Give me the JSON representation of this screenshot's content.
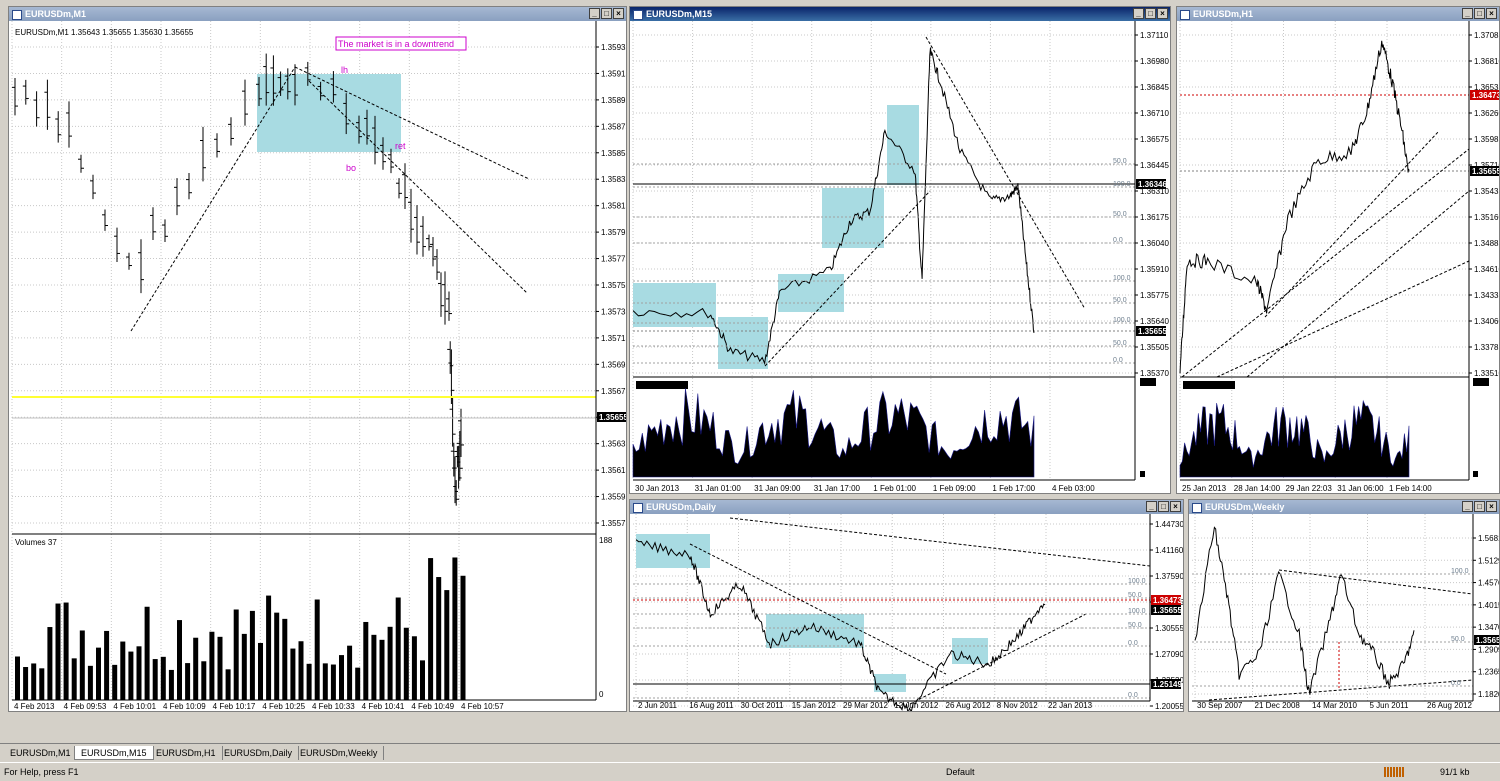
{
  "windows": {
    "m1": {
      "title": "EURUSDm,M1",
      "info": "EURUSDm,M1  1.35643 1.35655 1.35630 1.35655",
      "annotation": "The market is in a downtrend",
      "labels": {
        "lh": "lh",
        "ret": "ret",
        "bo": "bo"
      },
      "price_ticks": [
        "1.35935",
        "1.35915",
        "1.35895",
        "1.35875",
        "1.35855",
        "1.35835",
        "1.35815",
        "1.35795",
        "1.35775",
        "1.35755",
        "1.35735",
        "1.35715",
        "1.35695",
        "1.35675",
        "1.35655",
        "1.35635",
        "1.35615",
        "1.35595",
        "1.35575"
      ],
      "current_price": "1.35655",
      "time_ticks": [
        "4 Feb 2013",
        "4 Feb 09:53",
        "4 Feb 10:01",
        "4 Feb 10:09",
        "4 Feb 10:17",
        "4 Feb 10:25",
        "4 Feb 10:33",
        "4 Feb 10:41",
        "4 Feb 10:49",
        "4 Feb 10:57"
      ],
      "volumes_label": "Volumes 37",
      "vol_max": "188",
      "vol_min": "0"
    },
    "m15": {
      "title": "EURUSDm,M15",
      "price_ticks": [
        "1.37110",
        "1.36980",
        "1.36845",
        "1.36710",
        "1.36575",
        "1.36445",
        "1.36310",
        "1.36175",
        "1.36040",
        "1.35910",
        "1.35775",
        "1.35640",
        "1.35505",
        "1.35370"
      ],
      "fib_levels": [
        "50.0",
        "100.0",
        "50.0",
        "0.0",
        "100.0",
        "50.0",
        "100.0",
        "50.0",
        "0.0"
      ],
      "marked_prices": [
        "1.36346",
        "1.35655"
      ],
      "time_ticks": [
        "30 Jan 2013",
        "31 Jan 01:00",
        "31 Jan 09:00",
        "31 Jan 17:00",
        "1 Feb 01:00",
        "1 Feb 09:00",
        "1 Feb 17:00",
        "4 Feb 03:00"
      ]
    },
    "h1": {
      "title": "EURUSDm,H1",
      "price_ticks": [
        "1.37085",
        "1.36810",
        "1.36535",
        "1.36260",
        "1.35985",
        "1.35710",
        "1.35435",
        "1.35160",
        "1.34885",
        "1.34610",
        "1.34335",
        "1.34060",
        "1.33785",
        "1.33510"
      ],
      "marked_prices": [
        "1.36473",
        "1.35655"
      ],
      "time_ticks": [
        "25 Jan 2013",
        "28 Jan 14:00",
        "29 Jan 22:03",
        "31 Jan 06:00",
        "1 Feb 14:00"
      ]
    },
    "daily": {
      "title": "EURUSDm,Daily",
      "price_ticks": [
        "1.44730",
        "1.41160",
        "1.37590",
        "1.34125",
        "1.30555",
        "1.27090",
        "1.23520",
        "1.20055"
      ],
      "fib_levels": [
        "100.0",
        "50.0",
        "100.0",
        "50.0",
        "0.0",
        "0.0"
      ],
      "marked_prices": [
        "1.36473",
        "1.35655",
        "1.25149"
      ],
      "time_ticks": [
        "2 Jun 2011",
        "16 Aug 2011",
        "30 Oct 2011",
        "15 Jan 2012",
        "29 Mar 2012",
        "12 Jun 2012",
        "26 Aug 2012",
        "8 Nov 2012",
        "22 Jan 2013"
      ]
    },
    "weekly": {
      "title": "EURUSDm,Weekly",
      "price_ticks": [
        "1.56815",
        "1.51290",
        "1.45760",
        "1.40150",
        "1.34705",
        "1.29095",
        "1.23650",
        "1.18205"
      ],
      "fib_levels": [
        "100.0",
        "50.0",
        "0.0"
      ],
      "marked_prices": [
        "1.35655"
      ],
      "time_ticks": [
        "30 Sep 2007",
        "21 Dec 2008",
        "14 Mar 2010",
        "5 Jun 2011",
        "26 Aug 2012"
      ]
    }
  },
  "tabs": [
    "EURUSDm,M1",
    "EURUSDm,M15",
    "EURUSDm,H1",
    "EURUSDm,Daily",
    "EURUSDm,Weekly"
  ],
  "status": {
    "help": "For Help, press F1",
    "profile": "Default",
    "traffic": "91/1 kb"
  }
}
